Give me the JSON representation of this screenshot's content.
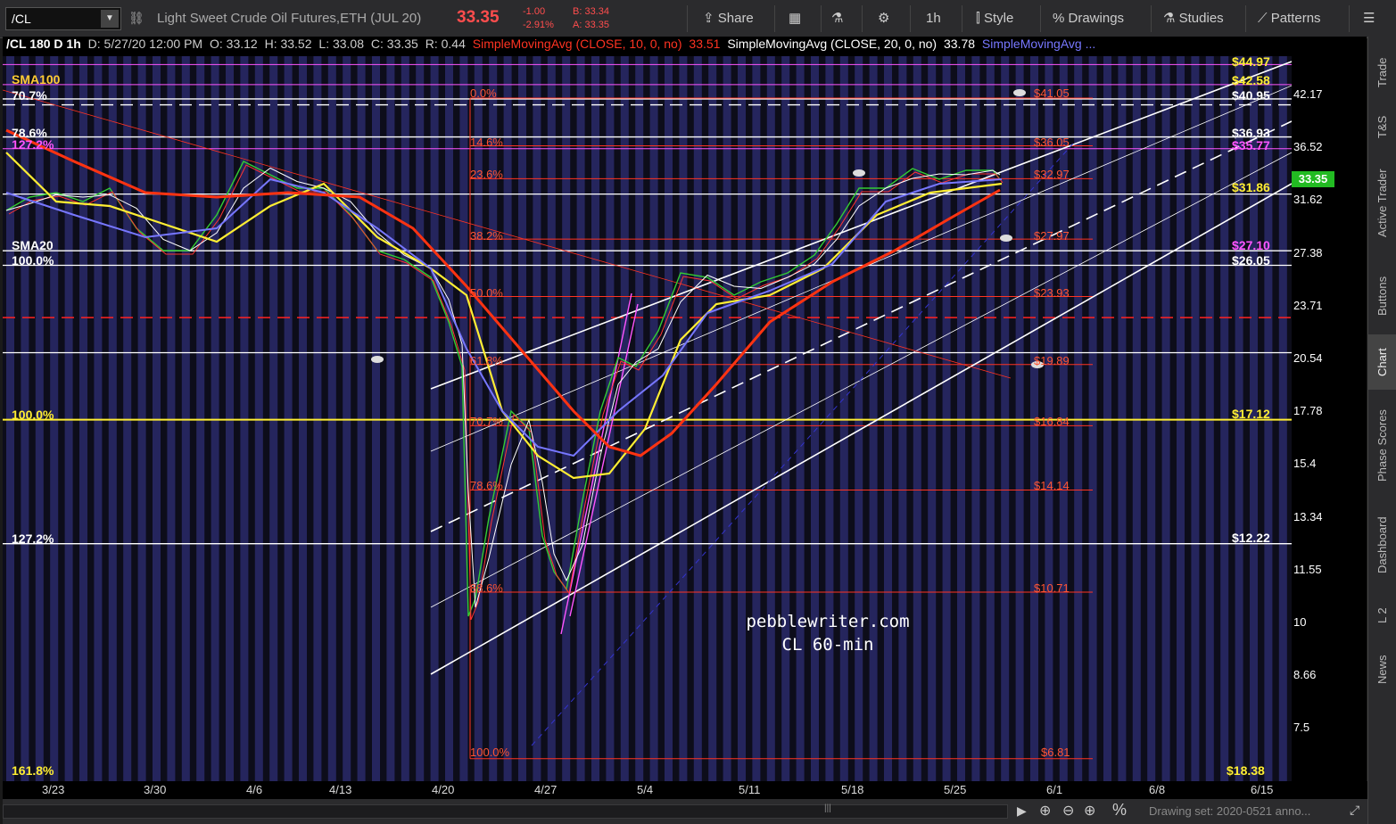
{
  "toolbar": {
    "symbol": "/CL",
    "instrument": "Light Sweet Crude Oil Futures,ETH (JUL 20)",
    "last_price": "33.35",
    "change": "-1.00",
    "change_pct": "-2.91%",
    "bid": "B: 33.34",
    "ask": "A: 33.35",
    "share_label": "Share",
    "timeframe_label": "1h",
    "style_label": "Style",
    "drawings_label": "Drawings",
    "studies_label": "Studies",
    "patterns_label": "Patterns"
  },
  "header": {
    "title": "/CL 180 D 1h",
    "datetime": "D: 5/27/20 12:00 PM",
    "open": "O: 33.12",
    "high": "H: 33.52",
    "low": "L: 33.08",
    "close": "C: 33.35",
    "range": "R: 0.44",
    "sma10_label": "SimpleMovingAvg (CLOSE, 10, 0, no)",
    "sma10_value": "33.51",
    "sma20_label": "SimpleMovingAvg (CLOSE, 20, 0, no)",
    "sma20_value": "33.78",
    "sma_more_label": "SimpleMovingAvg ..."
  },
  "left_labels": [
    "SMA100",
    "70.7%",
    "78.6%",
    "127.2%",
    "SMA20",
    "100.0%",
    "100.0%",
    "127.2%",
    "161.8%"
  ],
  "fib_labels": [
    "0.0%",
    "14.6%",
    "23.6%",
    "38.2%",
    "50.0%",
    "61.8%",
    "70.7%",
    "78.6%",
    "88.6%",
    "100.0%"
  ],
  "fib_prices": [
    "$41.05",
    "$36.05",
    "$32.97",
    "$27.97",
    "$23.93",
    "$19.89",
    "$16.84",
    "$14.14",
    "$10.71",
    "$6.81"
  ],
  "right_level_labels": [
    "$44.97",
    "$42.58",
    "$40.95",
    "$36.93",
    "$35.77",
    "$31.86",
    "$27.10",
    "$26.05",
    "$17.12",
    "$12.22",
    "$18.38"
  ],
  "y_ticks": [
    "42.17",
    "36.52",
    "31.62",
    "27.38",
    "23.71",
    "20.54",
    "17.78",
    "15.4",
    "13.34",
    "11.55",
    "10",
    "8.66",
    "7.5"
  ],
  "current_price_marker": "33.35",
  "x_ticks": [
    "3/23",
    "3/30",
    "4/6",
    "4/13",
    "4/20",
    "4/27",
    "5/4",
    "5/11",
    "5/18",
    "5/25",
    "6/1",
    "6/8",
    "6/15"
  ],
  "watermark": {
    "line1": "pebblewriter.com",
    "line2": "CL 60-min"
  },
  "sidebar_tabs": [
    "Trade",
    "T&S",
    "Active Trader",
    "Buttons",
    "Chart",
    "Phase Scores",
    "Dashboard",
    "L 2",
    "News"
  ],
  "drawing_set": "Drawing set: 2020-0521 anno...",
  "colors": {
    "bg": "#0d0d1a",
    "stripe": "#2a2a6a",
    "fib": "#ff3322",
    "sma10": "#ffffff",
    "sma20": "#ffee33",
    "sma_blue": "#7777ff",
    "sma_red": "#ff3311",
    "price_up": "#33cc33",
    "price_down": "#ff3333"
  },
  "chart_data": {
    "type": "line",
    "title": "/CL 180 D 1h",
    "x": [
      "3/23",
      "3/30",
      "4/6",
      "4/13",
      "4/20",
      "4/27",
      "5/4",
      "5/11",
      "5/18",
      "5/25"
    ],
    "series": [
      {
        "name": "CL",
        "values": [
          31.6,
          27.4,
          31.6,
          27.4,
          20.5,
          11.5,
          23.7,
          25.0,
          31.6,
          33.35
        ]
      }
    ],
    "ylim": [
      6.5,
      46
    ]
  }
}
